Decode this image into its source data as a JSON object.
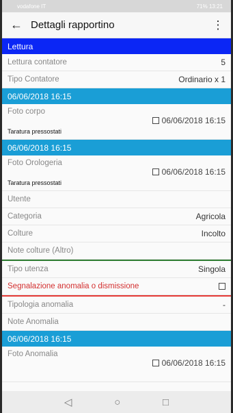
{
  "statusbar": {
    "carrier": "vodafone IT",
    "right": "71% 13:21"
  },
  "appbar": {
    "title": "Dettagli rapportino"
  },
  "sections": {
    "lettura": "Lettura",
    "date1": "06/06/2018 16:15",
    "date2": "06/06/2018 16:15",
    "date3": "06/06/2018 16:15"
  },
  "rows": {
    "lettura_contatore": {
      "label": "Lettura contatore",
      "value": "5"
    },
    "tipo_contatore": {
      "label": "Tipo Contatore",
      "value": "Ordinario x 1"
    },
    "utente": {
      "label": "Utente",
      "value": ""
    },
    "categoria": {
      "label": "Categoria",
      "value": "Agricola"
    },
    "colture": {
      "label": "Colture",
      "value": "Incolto"
    },
    "note_colture": {
      "label": "Note colture (Altro)",
      "value": ""
    },
    "tipo_utenza": {
      "label": "Tipo utenza",
      "value": "Singola"
    },
    "segnalazione": {
      "label": "Segnalazione anomalia o dismissione"
    },
    "tipologia_anomalia": {
      "label": "Tipologia anomalia",
      "value": "-"
    },
    "note_anomalia": {
      "label": "Note Anomalia",
      "value": ""
    }
  },
  "photos": {
    "corpo": {
      "label": "Foto corpo",
      "sub": "Taratura pressostati",
      "stamp": "06/06/2018 16:15"
    },
    "orologeria": {
      "label": "Foto Orologeria",
      "sub": "Taratura pressostati",
      "stamp": "06/06/2018 16:15"
    },
    "anomalia": {
      "label": "Foto Anomalia",
      "stamp": "06/06/2018 16:15"
    }
  },
  "icons": {
    "back": "arrow-back-icon",
    "menu": "more-vertical-icon"
  }
}
